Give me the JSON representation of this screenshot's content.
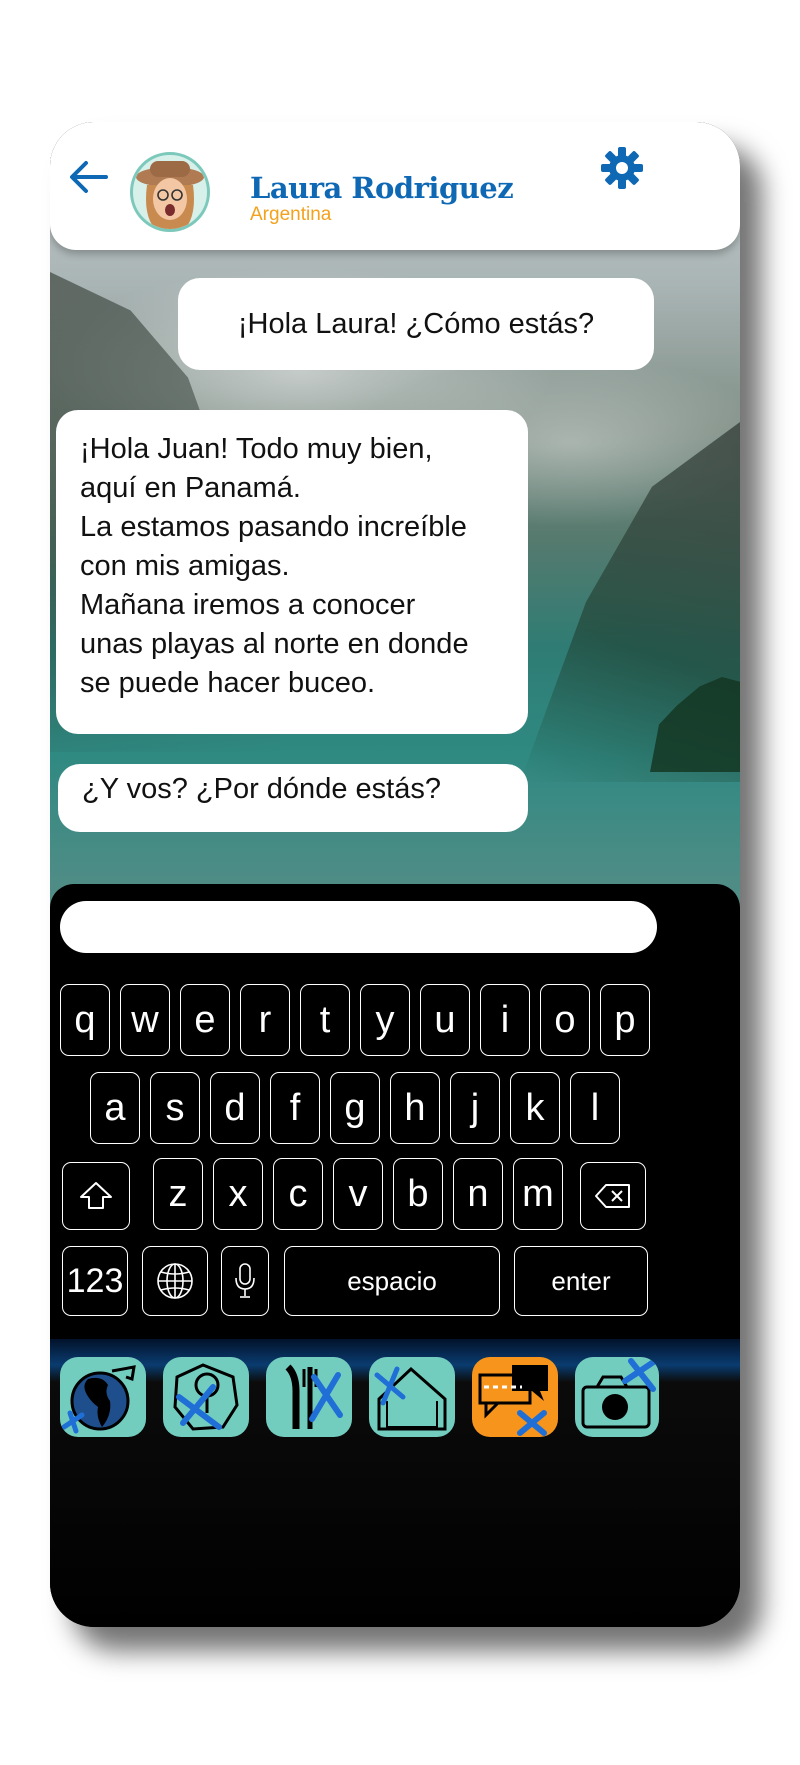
{
  "header": {
    "contact_name": "Laura Rodriguez",
    "contact_location": "Argentina",
    "accent_color": "#0e68b4",
    "location_color": "#f4a11c",
    "icons": {
      "back": "arrow-left-icon",
      "settings": "gear-icon"
    }
  },
  "messages": [
    {
      "direction": "outgoing",
      "lines": [
        "¡Hola Laura! ¿Cómo estás?"
      ]
    },
    {
      "direction": "incoming",
      "lines": [
        "¡Hola Juan! Todo muy bien,",
        "aquí en Panamá.",
        "La estamos pasando increíble",
        "con mis amigas.",
        "Mañana iremos a conocer",
        "unas playas al norte en donde",
        "se puede hacer buceo."
      ]
    },
    {
      "direction": "incoming",
      "lines": [
        "¿Y vos? ¿Por dónde estás?"
      ]
    }
  ],
  "composer": {
    "value": ""
  },
  "keyboard": {
    "row1": [
      "q",
      "w",
      "e",
      "r",
      "t",
      "y",
      "u",
      "i",
      "o",
      "p"
    ],
    "row2": [
      "a",
      "s",
      "d",
      "f",
      "g",
      "h",
      "j",
      "k",
      "l"
    ],
    "row3": [
      "z",
      "x",
      "c",
      "v",
      "b",
      "n",
      "m"
    ],
    "numbers_key": "123",
    "space_key": "espacio",
    "enter_key": "enter",
    "icons": {
      "shift": "shift-icon",
      "backspace": "backspace-icon",
      "globe": "globe-icon",
      "mic": "microphone-icon"
    }
  },
  "nav": {
    "items": [
      {
        "icon": "globe-americas-icon",
        "active": false
      },
      {
        "icon": "map-compass-icon",
        "active": false
      },
      {
        "icon": "restaurant-icon",
        "active": false
      },
      {
        "icon": "home-icon",
        "active": false
      },
      {
        "icon": "chat-icon",
        "active": true
      },
      {
        "icon": "camera-icon",
        "active": false
      }
    ],
    "active_color": "#f6941c",
    "inactive_color": "#73cdbf"
  }
}
